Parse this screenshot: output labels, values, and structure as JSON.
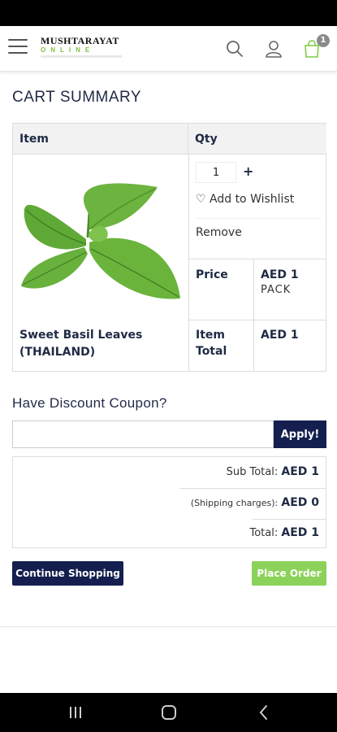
{
  "brand": {
    "logo_line1": "MUSHTARAYAT",
    "logo_line2": "ONLINE"
  },
  "header": {
    "cart_count": "1",
    "icons": [
      "menu-icon",
      "search-icon",
      "user-icon",
      "shopping-bag-icon"
    ]
  },
  "page_title": "CART SUMMARY",
  "cart": {
    "col_item": "Item",
    "col_qty": "Qty",
    "item": {
      "name": "Sweet Basil Leaves (THAILAND)",
      "qty": "1",
      "plus": "+",
      "wishlist_label": "Add to Wishlist",
      "remove_label": "Remove",
      "price_label": "Price",
      "price_value": "AED 1",
      "price_unit": "PACK",
      "item_total_label": "Item Total",
      "item_total_value": "AED 1"
    }
  },
  "coupon": {
    "title": "Have Discount Coupon?",
    "input_value": "",
    "apply_label": "Apply!"
  },
  "totals": {
    "sub_total_label": "Sub Total:",
    "sub_total_value": "AED 1",
    "shipping_label": "(Shipping charges):",
    "shipping_value": "AED 0",
    "total_label": "Total:",
    "total_value": "AED 1"
  },
  "actions": {
    "continue_label": "Continue Shopping",
    "place_order_label": "Place Order"
  },
  "colors": {
    "primary": "#141f4f",
    "accent_green": "#8cd25a",
    "text": "#1f2a44"
  }
}
